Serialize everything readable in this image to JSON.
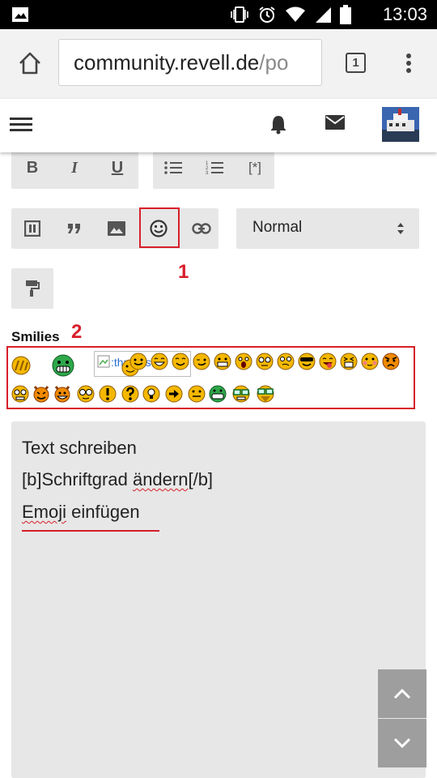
{
  "status_bar": {
    "time": "13:03"
  },
  "browser": {
    "url_domain": "community.revell.de",
    "url_path": "/po",
    "tab_count": "1"
  },
  "toolbar": {
    "bold": "B",
    "italic": "I",
    "underline": "U",
    "list_item": "[*]",
    "format_value": "Normal"
  },
  "annotations": {
    "emoji_button": "1",
    "smilies_panel": "2"
  },
  "smilies": {
    "label": "Smilies",
    "broken_image_alt": ":thumbsup:"
  },
  "editor": {
    "line1": "Text schreiben",
    "line2_pre": "[b]Schriftgrad ",
    "line2_word": "ändern",
    "line2_post": "[/b]",
    "line3_word1": "Emoji",
    "line3_word2": "einfügen"
  },
  "colors": {
    "annotation_red": "#d81e2a",
    "toolbar_gray": "#e7e7e7",
    "scroll_button_gray": "#9e9e9e"
  }
}
